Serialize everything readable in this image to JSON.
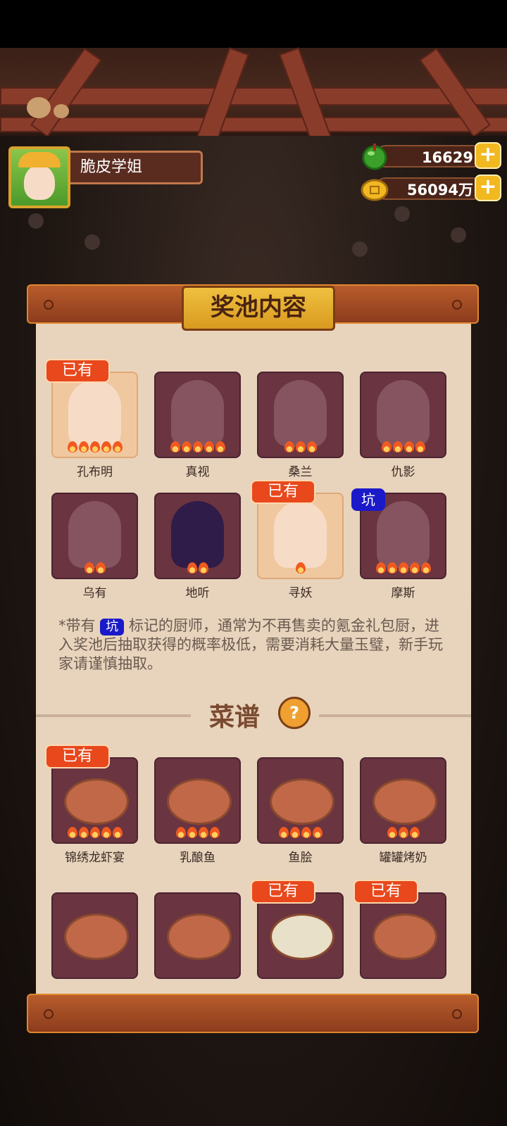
{
  "profile": {
    "name": "脆皮学姐"
  },
  "currency": {
    "jade": "16629",
    "coins": "56094万",
    "jade_color": "#3aa02a",
    "coin_color": "#f2b820"
  },
  "panel": {
    "title": "奖池内容"
  },
  "chefs": [
    {
      "name": "孔布明",
      "owned_badge": "已有",
      "flames": 5
    },
    {
      "name": "真视",
      "flames": 5
    },
    {
      "name": "桑兰",
      "flames": 3
    },
    {
      "name": "仇影",
      "flames": 4
    },
    {
      "name": "乌有",
      "flames": 2
    },
    {
      "name": "地听",
      "flames": 2
    },
    {
      "name": "寻妖",
      "owned_badge": "已有",
      "flames": 1
    },
    {
      "name": "摩斯",
      "pit_badge": "坑",
      "flames": 5
    }
  ],
  "note": {
    "prefix": "*带有",
    "pit": "坑",
    "suffix": " 标记的厨师，通常为不再售卖的氪金礼包厨，进入奖池后抽取获得的概率极低，需要消耗大量玉璧，新手玩家请谨慎抽取。"
  },
  "recipes_section": {
    "title": "菜谱",
    "help_icon": "?"
  },
  "recipes": [
    {
      "name": "锦绣龙虾宴",
      "owned_badge": "已有",
      "flames": 5
    },
    {
      "name": "乳酿鱼",
      "flames": 4
    },
    {
      "name": "鱼脍",
      "flames": 4
    },
    {
      "name": "罐罐烤奶",
      "flames": 3
    },
    {
      "name": ""
    },
    {
      "name": ""
    },
    {
      "name": "",
      "owned_badge": "已有"
    },
    {
      "name": "",
      "owned_badge": "已有"
    }
  ]
}
